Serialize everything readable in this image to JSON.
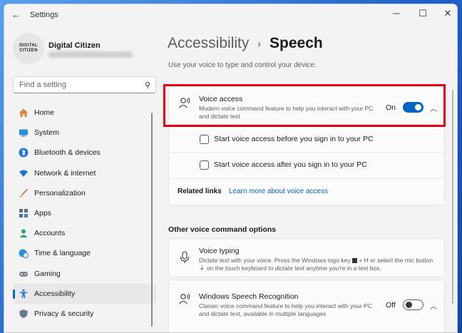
{
  "window": {
    "title": "Settings"
  },
  "user": {
    "name": "Digital Citizen",
    "avatar_text": [
      "DIGITAL",
      "CITIZEN"
    ]
  },
  "search": {
    "placeholder": "Find a setting"
  },
  "sidebar": {
    "items": [
      {
        "label": "Home",
        "icon": "home-icon",
        "active": false
      },
      {
        "label": "System",
        "icon": "monitor-icon",
        "active": false
      },
      {
        "label": "Bluetooth & devices",
        "icon": "bluetooth-icon",
        "active": false
      },
      {
        "label": "Network & internet",
        "icon": "wifi-icon",
        "active": false
      },
      {
        "label": "Personalization",
        "icon": "brush-icon",
        "active": false
      },
      {
        "label": "Apps",
        "icon": "apps-grid-icon",
        "active": false
      },
      {
        "label": "Accounts",
        "icon": "person-icon",
        "active": false
      },
      {
        "label": "Time & language",
        "icon": "globe-clock-icon",
        "active": false
      },
      {
        "label": "Gaming",
        "icon": "gamepad-icon",
        "active": false
      },
      {
        "label": "Accessibility",
        "icon": "accessibility-icon",
        "active": true
      },
      {
        "label": "Privacy & security",
        "icon": "shield-icon",
        "active": false
      }
    ]
  },
  "breadcrumb": {
    "parent": "Accessibility",
    "separator": "›",
    "current": "Speech"
  },
  "page": {
    "description": "Use your voice to type and control your device."
  },
  "voice_access": {
    "title": "Voice access",
    "subtitle": "Modern voice command feature to help you interact with your PC and dictate text",
    "state_label": "On",
    "on": true,
    "options": [
      {
        "label": "Start voice access before you sign in to your PC",
        "checked": false
      },
      {
        "label": "Start voice access after you sign in to your PC",
        "checked": false
      }
    ],
    "related_label": "Related links",
    "related_link": "Learn more about voice access"
  },
  "other": {
    "section_title": "Other voice command options",
    "voice_typing": {
      "title": "Voice typing",
      "subtitle_1": "Dictate text with your voice. Press the Windows logo key",
      "subtitle_1b": "+ H or select the mic button",
      "subtitle_2": "on the touch keyboard to dictate text anytime you're in a text box."
    },
    "speech_recognition": {
      "title": "Windows Speech Recognition",
      "subtitle": "Classic voice command feature to help you interact with your PC and dictate text, available in multiple languages",
      "state_label": "Off",
      "on": false
    }
  },
  "colors": {
    "accent": "#0067c0",
    "highlight": "#e60012"
  }
}
